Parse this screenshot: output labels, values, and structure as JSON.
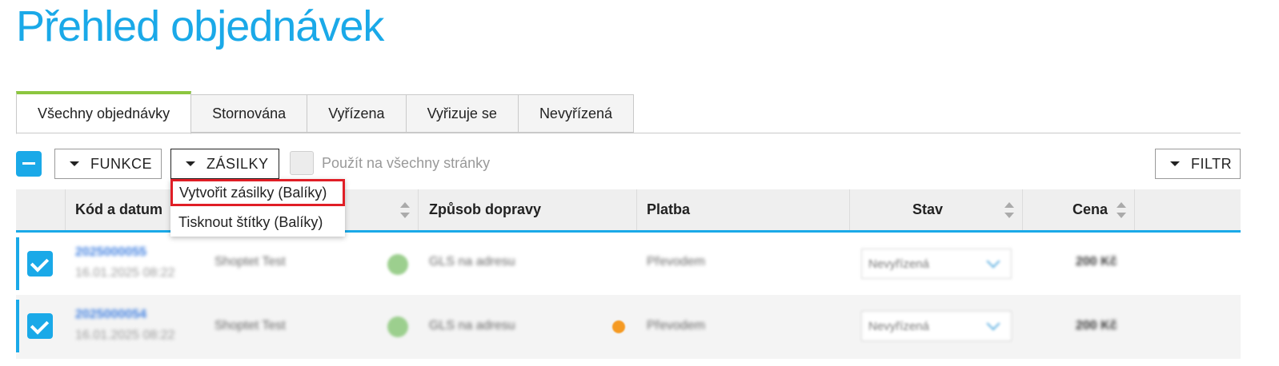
{
  "page_title": "Přehled objednávek",
  "tabs": [
    {
      "label": "Všechny objednávky",
      "active": true
    },
    {
      "label": "Stornována"
    },
    {
      "label": "Vyřízena"
    },
    {
      "label": "Vyřizuje se"
    },
    {
      "label": "Nevyřízená"
    }
  ],
  "toolbar": {
    "funkce_label": "FUNKCE",
    "zasilky_label": "ZÁSILKY",
    "apply_all_label": "Použít na všechny stránky",
    "filter_label": "FILTR"
  },
  "dropdown": {
    "items": [
      "Vytvořit zásilky (Balíky)",
      "Tisknout štítky (Balíky)"
    ]
  },
  "table": {
    "headers": {
      "code_date": "Kód a datum",
      "shipping": "Způsob dopravy",
      "payment": "Platba",
      "status": "Stav",
      "price": "Cena"
    },
    "rows": [
      {
        "code": "2025000055",
        "date": "16.01.2025 08:22",
        "customer": "Shoptet Test",
        "shipping": "GLS na adresu",
        "payment": "Převodem",
        "status": "Nevyřízená",
        "price": "200 Kč"
      },
      {
        "code": "2025000054",
        "date": "16.01.2025 08:22",
        "customer": "Shoptet Test",
        "shipping": "GLS na adresu",
        "payment": "Převodem",
        "status": "Nevyřízená",
        "price": "200 Kč"
      }
    ]
  },
  "colors": {
    "accent": "#1aa9e8",
    "active_tab": "#8cc63f",
    "highlight": "#e01e26"
  }
}
